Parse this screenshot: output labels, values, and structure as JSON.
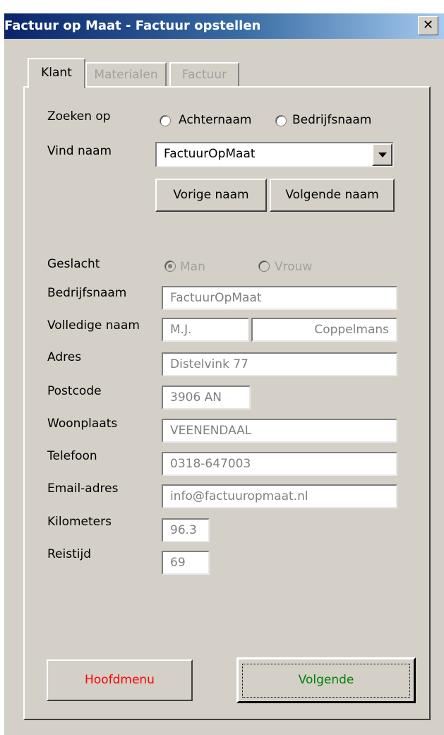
{
  "window": {
    "title": "Factuur op Maat - Factuur opstellen",
    "close_glyph": "✕"
  },
  "tabs": [
    {
      "label": "Klant",
      "active": true
    },
    {
      "label": "Materialen",
      "active": false
    },
    {
      "label": "Factuur",
      "active": false
    }
  ],
  "search": {
    "label": "Zoeken op",
    "option_achternaam": "Achternaam",
    "option_bedrijfsnaam": "Bedrijfsnaam",
    "find_label": "Vind naam",
    "find_value": "FactuurOpMaat",
    "prev_button": "Vorige naam",
    "next_button": "Volgende naam"
  },
  "form": {
    "geslacht_label": "Geslacht",
    "geslacht_man": "Man",
    "geslacht_vrouw": "Vrouw",
    "bedrijfsnaam_label": "Bedrijfsnaam",
    "bedrijfsnaam_value": "FactuurOpMaat",
    "volledige_naam_label": "Volledige naam",
    "voorletters_value": "M.J.",
    "achternaam_value": "Coppelmans",
    "adres_label": "Adres",
    "adres_value": "Distelvink 77",
    "postcode_label": "Postcode",
    "postcode_value": "3906 AN",
    "woonplaats_label": "Woonplaats",
    "woonplaats_value": "VEENENDAAL",
    "telefoon_label": "Telefoon",
    "telefoon_value": "0318-647003",
    "email_label": "Email-adres",
    "email_value": "info@factuuropmaat.nl",
    "kilometers_label": "Kilometers",
    "kilometers_value": "96.3",
    "reistijd_label": "Reistijd",
    "reistijd_value": "69"
  },
  "footer": {
    "hoofdmenu": "Hoofdmenu",
    "volgende": "Volgende"
  },
  "colors": {
    "hoofdmenu_text": "#ff0000",
    "volgende_text": "#008000",
    "dialog_bg": "#d4d0c8"
  }
}
